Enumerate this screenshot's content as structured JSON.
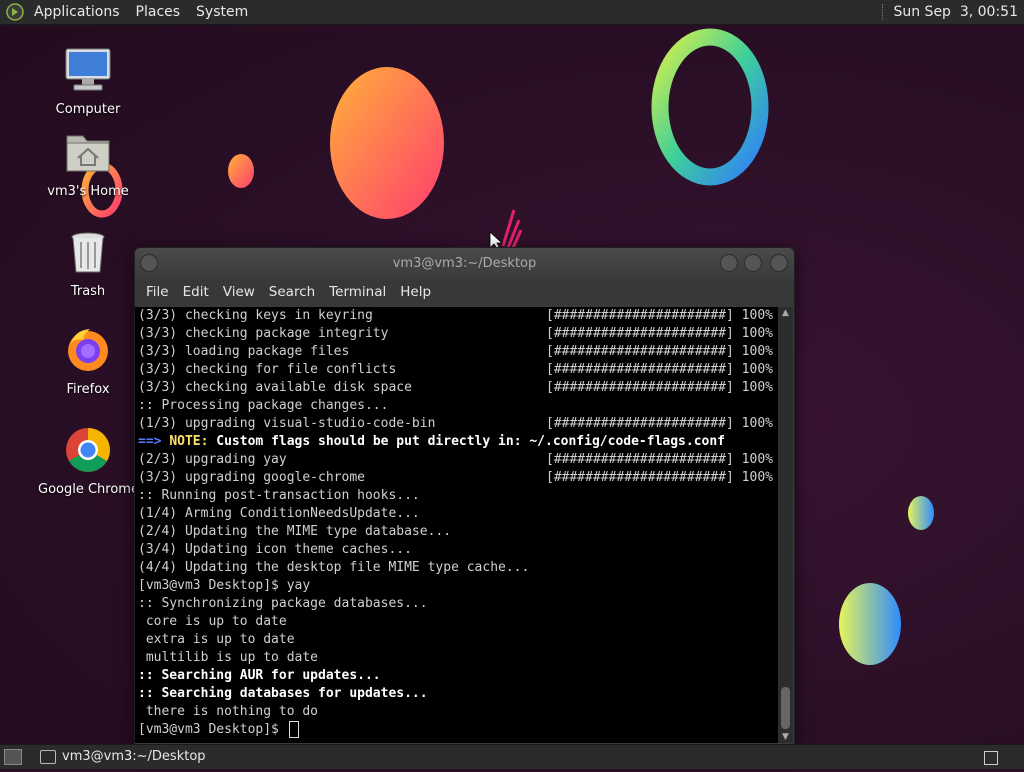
{
  "top_panel": {
    "menus": [
      "Applications",
      "Places",
      "System"
    ],
    "clock": "Sun Sep  3, 00:51"
  },
  "desktop_icons": [
    {
      "label": "Computer",
      "icon": "computer-icon"
    },
    {
      "label": "vm3's Home",
      "icon": "home-folder-icon"
    },
    {
      "label": "Trash",
      "icon": "trash-icon"
    },
    {
      "label": "Firefox",
      "icon": "firefox-icon"
    },
    {
      "label": "Google Chrome",
      "icon": "chrome-icon"
    }
  ],
  "terminal": {
    "title": "vm3@vm3:~/Desktop",
    "menu": [
      "File",
      "Edit",
      "View",
      "Search",
      "Terminal",
      "Help"
    ],
    "progress_bar": "[######################] 100%",
    "lines": [
      {
        "text": "(3/3) checking keys in keyring",
        "bar": true
      },
      {
        "text": "(3/3) checking package integrity",
        "bar": true
      },
      {
        "text": "(3/3) loading package files",
        "bar": true
      },
      {
        "text": "(3/3) checking for file conflicts",
        "bar": true
      },
      {
        "text": "(3/3) checking available disk space",
        "bar": true
      },
      {
        "text": ":: Processing package changes..."
      },
      {
        "text": "(1/3) upgrading visual-studio-code-bin",
        "bar": true
      },
      {
        "note": true,
        "arrow": "==>",
        "tag": "NOTE:",
        "text": " Custom flags should be put directly in: ~/.config/code-flags.conf"
      },
      {
        "text": "(2/3) upgrading yay",
        "bar": true
      },
      {
        "text": "(3/3) upgrading google-chrome",
        "bar": true
      },
      {
        "text": ":: Running post-transaction hooks..."
      },
      {
        "text": "(1/4) Arming ConditionNeedsUpdate..."
      },
      {
        "text": "(2/4) Updating the MIME type database..."
      },
      {
        "text": "(3/4) Updating icon theme caches..."
      },
      {
        "text": "(4/4) Updating the desktop file MIME type cache..."
      },
      {
        "text": "[vm3@vm3 Desktop]$ yay"
      },
      {
        "text": ":: Synchronizing package databases..."
      },
      {
        "text": " core is up to date"
      },
      {
        "text": " extra is up to date"
      },
      {
        "text": " multilib is up to date"
      },
      {
        "text": ":: Searching AUR for updates...",
        "bold": true
      },
      {
        "text": ":: Searching databases for updates...",
        "bold": true
      },
      {
        "text": " there is nothing to do"
      }
    ],
    "prompt": "[vm3@vm3 Desktop]$ "
  },
  "bottom_panel": {
    "task": "vm3@vm3:~/Desktop"
  },
  "colors": {
    "note_arrow": "#5b7cff",
    "note_tag": "#ffe066",
    "terminal_bg": "#000000"
  }
}
